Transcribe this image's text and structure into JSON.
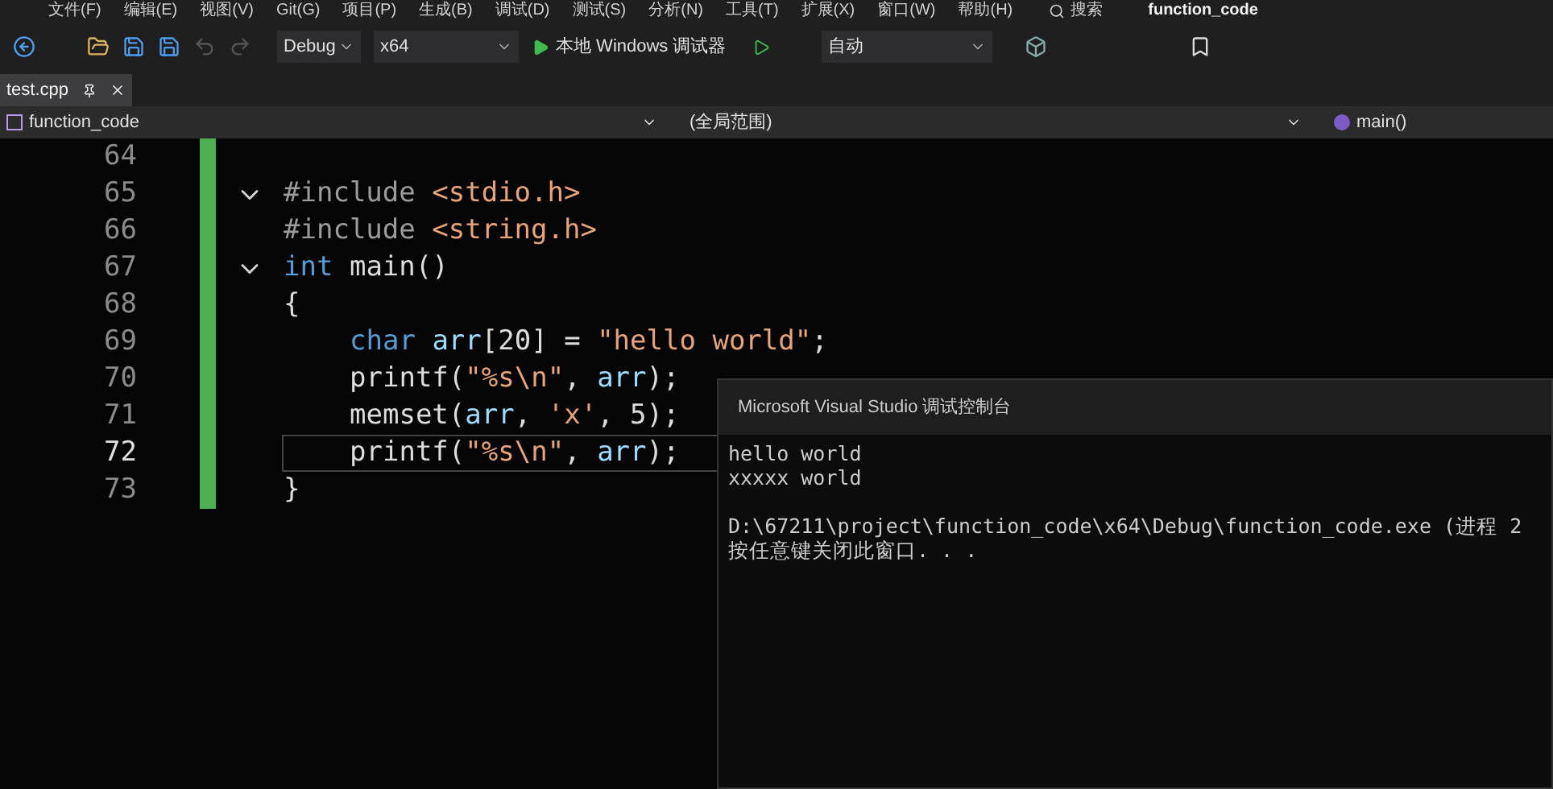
{
  "menu": [
    "文件(F)",
    "编辑(E)",
    "视图(V)",
    "Git(G)",
    "项目(P)",
    "生成(B)",
    "调试(D)",
    "测试(S)",
    "分析(N)",
    "工具(T)",
    "扩展(X)",
    "窗口(W)",
    "帮助(H)"
  ],
  "search": {
    "label": "搜索"
  },
  "window": {
    "title": "function_code"
  },
  "toolbar": {
    "configuration": "Debug",
    "platform": "x64",
    "run_label": "本地 Windows 调试器",
    "stack_frame": "自动"
  },
  "tabs": [
    {
      "label": "test.cpp",
      "selected": true
    }
  ],
  "navigation": {
    "project": "function_code",
    "scope": "(全局范围)",
    "member": "main()"
  },
  "editor": {
    "lines": [
      {
        "number": "64",
        "fold": false,
        "current": false
      },
      {
        "number": "65",
        "fold": true,
        "current": false,
        "indented": false,
        "tokens": [
          {
            "text": "#include ",
            "kind": "preproc"
          },
          {
            "text": "<stdio.h>",
            "kind": "string"
          }
        ]
      },
      {
        "number": "66",
        "fold": false,
        "current": false,
        "indented": false,
        "tokens": [
          {
            "text": "#include ",
            "kind": "preproc"
          },
          {
            "text": "<string.h>",
            "kind": "string"
          }
        ]
      },
      {
        "number": "67",
        "fold": true,
        "current": false,
        "indented": false,
        "tokens": [
          {
            "text": "int",
            "kind": "keyword"
          },
          {
            "text": " main()",
            "kind": "plain"
          }
        ]
      },
      {
        "number": "68",
        "fold": false,
        "current": false,
        "indented": false,
        "tokens": [
          {
            "text": "{",
            "kind": "plain"
          }
        ]
      },
      {
        "number": "69",
        "fold": false,
        "current": false,
        "indented": true,
        "tokens": [
          {
            "text": "char ",
            "kind": "keyword"
          },
          {
            "text": "arr",
            "kind": "variable"
          },
          {
            "text": "[20] = ",
            "kind": "plain"
          },
          {
            "text": "\"hello world\"",
            "kind": "string"
          },
          {
            "text": ";",
            "kind": "plain"
          }
        ]
      },
      {
        "number": "70",
        "fold": false,
        "current": false,
        "indented": true,
        "tokens": [
          {
            "text": "printf(",
            "kind": "plain"
          },
          {
            "text": "\"%s\\n\"",
            "kind": "string"
          },
          {
            "text": ", ",
            "kind": "plain"
          },
          {
            "text": "arr",
            "kind": "variable"
          },
          {
            "text": ");",
            "kind": "plain"
          }
        ]
      },
      {
        "number": "71",
        "fold": false,
        "current": false,
        "indented": true,
        "tokens": [
          {
            "text": "memset(",
            "kind": "plain"
          },
          {
            "text": "arr",
            "kind": "variable"
          },
          {
            "text": ", ",
            "kind": "plain"
          },
          {
            "text": "'x'",
            "kind": "string"
          },
          {
            "text": ", 5);",
            "kind": "plain"
          }
        ]
      },
      {
        "number": "72",
        "fold": false,
        "current": true,
        "indented": true,
        "tokens": [
          {
            "text": "printf(",
            "kind": "plain"
          },
          {
            "text": "\"%s\\n\"",
            "kind": "string"
          },
          {
            "text": ", ",
            "kind": "plain"
          },
          {
            "text": "arr",
            "kind": "variable"
          },
          {
            "text": ");",
            "kind": "plain"
          }
        ]
      },
      {
        "number": "73",
        "fold": false,
        "current": false,
        "indented": false,
        "tokens": [
          {
            "text": "}",
            "kind": "plain"
          }
        ]
      }
    ]
  },
  "console": {
    "title": "Microsoft Visual Studio 调试控制台",
    "paragraphs": [
      [
        "hello world",
        "xxxxx world"
      ],
      [
        "D:\\67211\\project\\function_code\\x64\\Debug\\function_code.exe (进程 2",
        "按任意键关闭此窗口. . ."
      ]
    ]
  }
}
